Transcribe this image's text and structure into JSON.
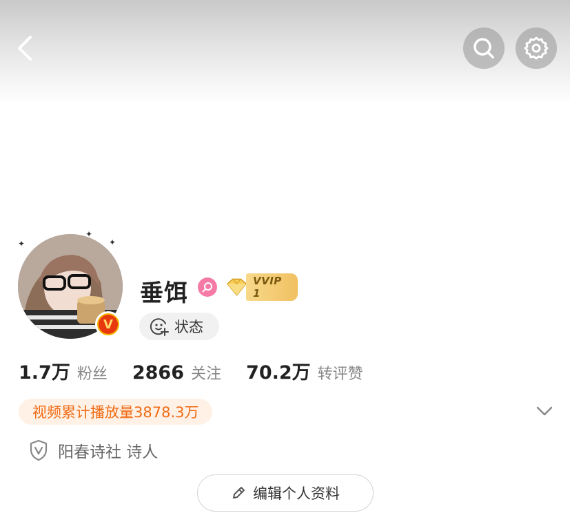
{
  "header": {
    "back_icon": "chevron-left-icon",
    "search_icon": "search-icon",
    "settings_icon": "gear-icon"
  },
  "profile": {
    "username": "垂饵",
    "gender_icon": "female-icon",
    "vip_label": "VVIP 1",
    "verified_badge_letter": "V",
    "status_label": "状态"
  },
  "stats": [
    {
      "value": "1.7万",
      "label": "粉丝"
    },
    {
      "value": "2866",
      "label": "关注"
    },
    {
      "value": "70.2万",
      "label": "转评赞"
    }
  ],
  "play_count": "视频累计播放量3878.3万",
  "verification": "阳春诗社 诗人",
  "edit_button": "编辑个人资料",
  "colors": {
    "accent_orange": "#f06b14",
    "play_count_bg": "#fff1e6",
    "gender_pink": "#f57aa6",
    "vip_gold": "#f1c062"
  }
}
